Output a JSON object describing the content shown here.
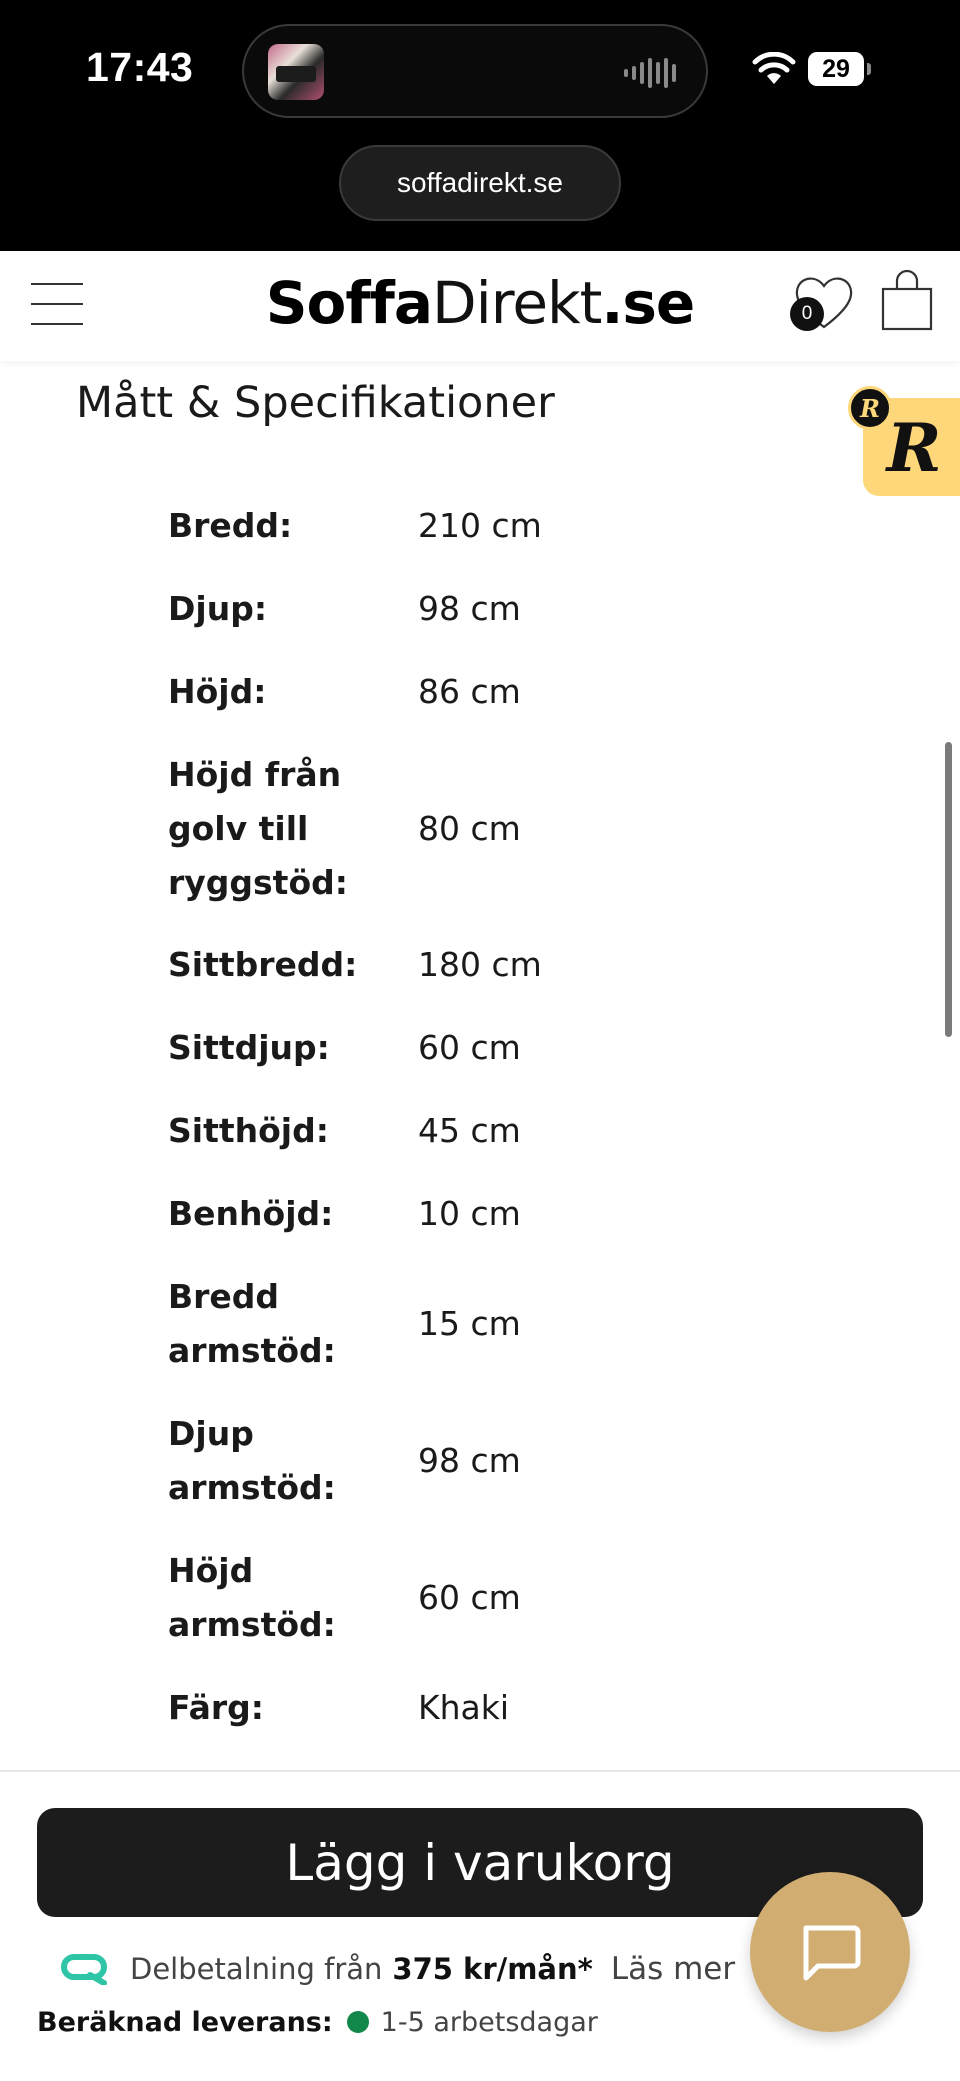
{
  "status_bar": {
    "time": "17:43",
    "battery": "29",
    "url": "soffadirekt.se"
  },
  "header": {
    "logo_bold": "Soffa",
    "logo_thin": "Direkt",
    "logo_suffix": ".se",
    "wishlist_count": "0",
    "icons": [
      "menu-icon",
      "heart-icon",
      "shopping-bag-icon"
    ]
  },
  "section": {
    "title": "Mått & Specifikationer"
  },
  "specs": [
    {
      "label": "Bredd:",
      "value": "210 cm"
    },
    {
      "label": "Djup:",
      "value": "98 cm"
    },
    {
      "label": "Höjd:",
      "value": "86 cm"
    },
    {
      "label": "Höjd från golv till ryggstöd:",
      "value": "80 cm"
    },
    {
      "label": "Sittbredd:",
      "value": "180 cm"
    },
    {
      "label": "Sittdjup:",
      "value": "60 cm"
    },
    {
      "label": "Sitthöjd:",
      "value": "45 cm"
    },
    {
      "label": "Benhöjd:",
      "value": "10 cm"
    },
    {
      "label": "Bredd armstöd:",
      "value": "15 cm"
    },
    {
      "label": "Djup armstöd:",
      "value": "98 cm"
    },
    {
      "label": "Höjd armstöd:",
      "value": "60 cm"
    },
    {
      "label": "Färg:",
      "value": "Khaki"
    }
  ],
  "reviews_badge": {
    "letter": "R"
  },
  "bottom_bar": {
    "cart_button": "Lägg i varukorg",
    "installment_text": "Delbetalning från",
    "installment_amount": "375 kr/mån*",
    "read_more": "Läs mer",
    "delivery_label": "Beräknad leverans:",
    "delivery_value": "1-5 arbetsdagar"
  },
  "colors": {
    "accent_cart": "#1c1c1c",
    "reviews_yellow": "#fdd77a",
    "chat_gold": "#d1ad72",
    "delivery_green": "#11884a",
    "installment_teal": "#2ec4a6"
  }
}
